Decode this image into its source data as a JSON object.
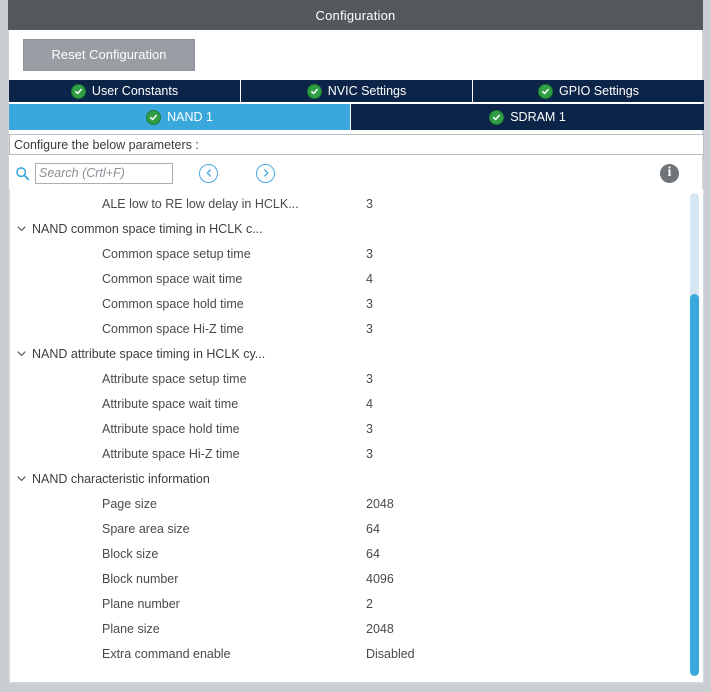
{
  "window": {
    "title": "Configuration"
  },
  "toolbar": {
    "reset_label": "Reset Configuration"
  },
  "tabs": {
    "row1": [
      {
        "label": "User Constants",
        "icon": "check-circle-icon",
        "active": false
      },
      {
        "label": "NVIC Settings",
        "icon": "check-circle-icon",
        "active": false
      },
      {
        "label": "GPIO Settings",
        "icon": "check-circle-icon",
        "active": false
      }
    ],
    "row2": [
      {
        "label": "NAND 1",
        "icon": "check-circle-icon",
        "active": true
      },
      {
        "label": "SDRAM 1",
        "icon": "check-circle-icon",
        "active": false
      }
    ]
  },
  "configure_bar": {
    "text": "Configure the below parameters :"
  },
  "search": {
    "placeholder": "Search (Crtl+F)",
    "value": "",
    "icon": "search-icon",
    "prev_icon": "chevron-left-circle-icon",
    "next_icon": "chevron-right-circle-icon",
    "info_icon": "info-icon",
    "info_glyph": "i"
  },
  "tree": {
    "rows": [
      {
        "type": "child",
        "inline": true,
        "label": "ALE low to RE low delay in HCLK...",
        "value": "3"
      },
      {
        "type": "group",
        "expanded": true,
        "label": "NAND common space timing in HCLK c...",
        "value": ""
      },
      {
        "type": "child",
        "label": "Common space setup time",
        "value": "3"
      },
      {
        "type": "child",
        "label": "Common space wait time",
        "value": "4"
      },
      {
        "type": "child",
        "label": "Common space hold time",
        "value": "3"
      },
      {
        "type": "child",
        "label": "Common space Hi-Z time",
        "value": "3"
      },
      {
        "type": "group",
        "expanded": true,
        "label": "NAND attribute space timing in HCLK cy...",
        "value": ""
      },
      {
        "type": "child",
        "label": "Attribute space setup time",
        "value": "3"
      },
      {
        "type": "child",
        "label": "Attribute space wait time",
        "value": "4"
      },
      {
        "type": "child",
        "label": "Attribute space hold time",
        "value": "3"
      },
      {
        "type": "child",
        "label": "Attribute space Hi-Z time",
        "value": "3"
      },
      {
        "type": "group",
        "expanded": true,
        "label": "NAND characteristic information",
        "value": ""
      },
      {
        "type": "child",
        "label": "Page size",
        "value": "2048"
      },
      {
        "type": "child",
        "label": "Spare area size",
        "value": "64"
      },
      {
        "type": "child",
        "label": "Block size",
        "value": "64"
      },
      {
        "type": "child",
        "label": "Block number",
        "value": "4096"
      },
      {
        "type": "child",
        "label": "Plane number",
        "value": "2"
      },
      {
        "type": "child",
        "label": "Plane size",
        "value": "2048"
      },
      {
        "type": "child",
        "label": "Extra command enable",
        "value": "Disabled"
      }
    ]
  },
  "scrollbar": {
    "orientation": "vertical",
    "thumb_top_pct": 21,
    "thumb_height_pct": 79
  },
  "colors": {
    "titlebar": "#55585a",
    "tab_inactive": "#0b2447",
    "tab_active": "#3aa8dd",
    "check_green": "#2f9e44",
    "accent_blue": "#3aa8dd",
    "scroll_track": "#d6e7f4",
    "button_gray": "#989ea4",
    "frame_gray": "#c9ced3"
  }
}
